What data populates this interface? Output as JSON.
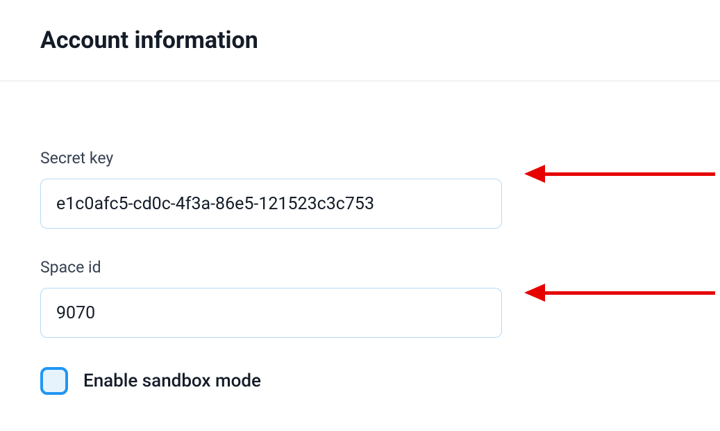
{
  "section": {
    "title": "Account information"
  },
  "fields": {
    "secret_key": {
      "label": "Secret key",
      "value": "e1c0afc5-cd0c-4f3a-86e5-121523c3c753"
    },
    "space_id": {
      "label": "Space id",
      "value": "9070"
    }
  },
  "checkbox": {
    "label": "Enable sandbox mode",
    "checked": false
  },
  "annotations": {
    "arrow_color": "#e60000"
  }
}
